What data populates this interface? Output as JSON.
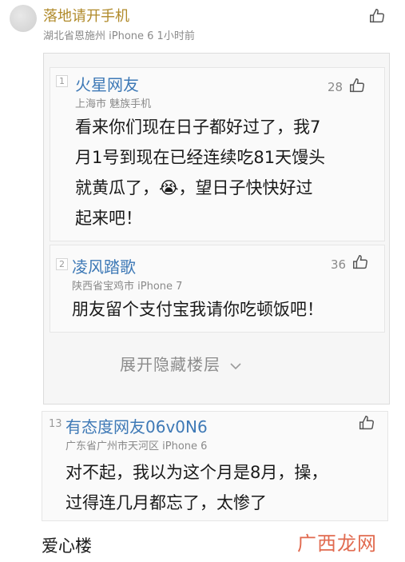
{
  "top_comment": {
    "username": "落地请开手机",
    "meta": "湖北省恩施州  iPhone 6   1小时前"
  },
  "replies": [
    {
      "floor": "1",
      "username": "火星网友",
      "meta": "上海市  魅族手机",
      "likes": "28",
      "lines": [
        "看来你们现在日子都好过了，我7",
        "月1号到现在已经连续吃81天馒头",
        "就黄瓜了，😭，望日子快快好过",
        "起来吧！"
      ]
    },
    {
      "floor": "2",
      "username": "凌风踏歌",
      "meta": "陕西省宝鸡市  iPhone 7",
      "likes": "36",
      "lines": [
        "朋友留个支付宝我请你吃顿饭吧！"
      ]
    }
  ],
  "expand_label": "展开隐藏楼层",
  "bottom_comment": {
    "floor": "13",
    "username": "有态度网友06v0N6",
    "meta": "广东省广州市天河区  iPhone 6",
    "lines": [
      "对不起，我以为这个月是8月，操，",
      "过得连几月都忘了，太惨了"
    ]
  },
  "footer_label": "爱心楼",
  "watermark": "广西龙网",
  "icons": {
    "like": "thumbs-up-icon",
    "expand": "chevron-down-icon"
  },
  "colors": {
    "username_gold": "#b08a2a",
    "username_blue": "#3e79b6",
    "watermark": "#e16a4f"
  }
}
